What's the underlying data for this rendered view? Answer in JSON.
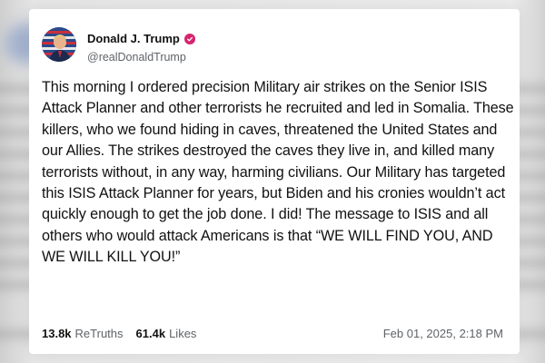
{
  "post": {
    "author_name": "Donald J. Trump",
    "author_handle": "@realDonaldTrump",
    "avatar_icon": "flag-portrait-avatar",
    "verified_icon": "verified-check-icon",
    "verified_color": "#d6246e",
    "text": "This morning I ordered precision Military air strikes on the Senior ISIS Attack Planner and other terrorists he recruited and led in Somalia. These killers, who we found hiding in caves, threatened the United States and our Allies. The strikes destroyed the caves they live in, and killed many terrorists without, in any way, harming civilians. Our Military has targeted this ISIS Attack Planner for years, but Biden and his cronies wouldn’t act quickly enough to get the job done. I did! The message to ISIS and all others who would attack Americans is that “WE WILL FIND YOU, AND WE WILL KILL YOU!”",
    "retruths_count": "13.8k",
    "retruths_label": "ReTruths",
    "likes_count": "61.4k",
    "likes_label": "Likes",
    "timestamp": "Feb 01, 2025, 2:18 PM"
  }
}
